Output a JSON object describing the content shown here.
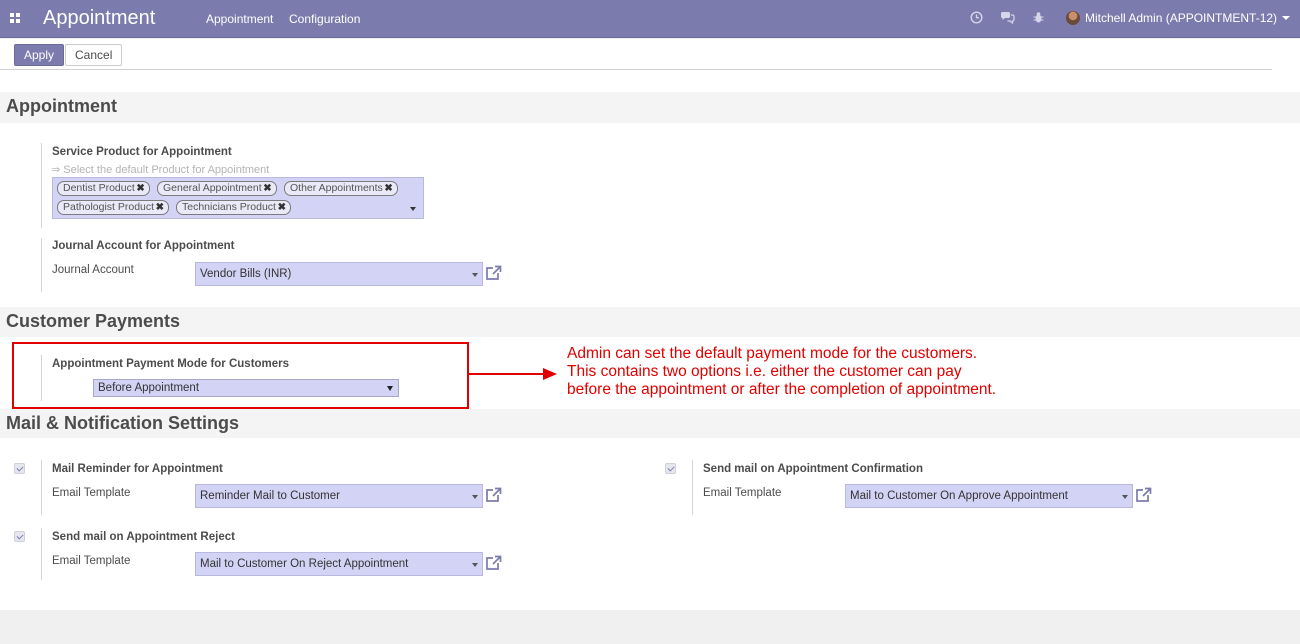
{
  "navbar": {
    "brand": "Appointment",
    "menu": [
      {
        "label": "Appointment"
      },
      {
        "label": "Configuration"
      }
    ],
    "user": "Mitchell Admin (APPOINTMENT-12)",
    "icons": [
      "clock-icon",
      "chat-icon",
      "bug-icon"
    ],
    "color": "#7c7bad"
  },
  "toolbar": {
    "apply_label": "Apply",
    "cancel_label": "Cancel"
  },
  "sections": {
    "appointment": {
      "title": "Appointment",
      "service_product": {
        "title": "Service Product for Appointment",
        "hint": "⇒ Select the default Product for Appointment",
        "tags": [
          "Dentist Product",
          "General Appointment",
          "Other Appointments",
          "Pathologist Product",
          "Technicians Product"
        ]
      },
      "journal": {
        "title": "Journal Account for Appointment",
        "label": "Journal Account",
        "value": "Vendor Bills (INR)"
      }
    },
    "payments": {
      "title": "Customer Payments",
      "payment_mode": {
        "title": "Appointment Payment Mode for Customers",
        "value": "Before Appointment"
      },
      "annotation": [
        "Admin can set the default payment mode for the customers.",
        "This contains two options i.e. either the customer can pay",
        "before the appointment or after the completion of appointment."
      ]
    },
    "mail": {
      "title": "Mail & Notification Settings",
      "reminder": {
        "title": "Mail Reminder for Appointment",
        "label": "Email Template",
        "value": "Reminder Mail to Customer",
        "checked": true
      },
      "confirmation": {
        "title": "Send mail on Appointment Confirmation",
        "label": "Email Template",
        "value": "Mail to Customer On Approve Appointment",
        "checked": true
      },
      "reject": {
        "title": "Send mail on Appointment Reject",
        "label": "Email Template",
        "value": "Mail to Customer On Reject Appointment",
        "checked": true
      }
    }
  }
}
